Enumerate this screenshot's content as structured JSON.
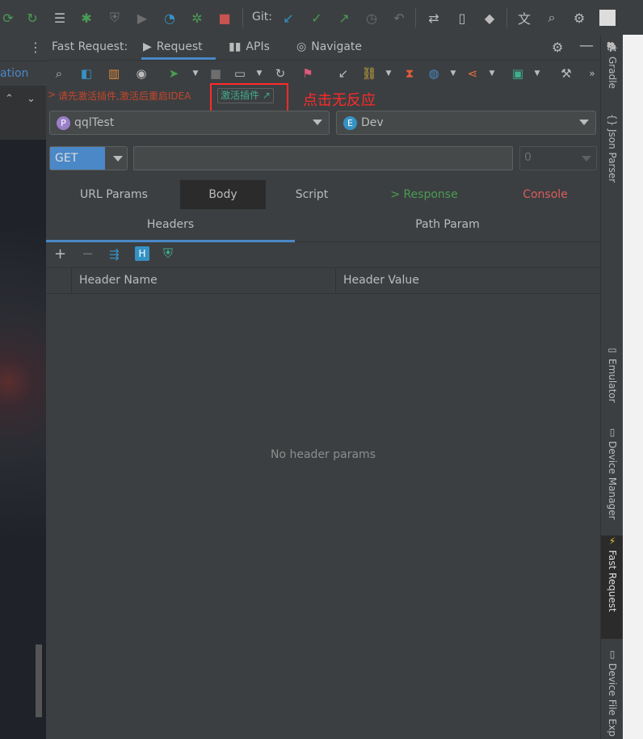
{
  "toolbar": {
    "git_label": "Git:"
  },
  "left": {
    "tab_label": "ation"
  },
  "tool_window": {
    "title": "Fast Request:",
    "tabs": [
      {
        "label": "Request",
        "active": true
      },
      {
        "label": "APIs",
        "active": false
      },
      {
        "label": "Navigate",
        "active": false
      }
    ]
  },
  "notice": {
    "prefix": ">",
    "message": "请先激活插件,激活后重启IDEA",
    "activate_link": "激活插件 ↗",
    "annotation": "点击无反应"
  },
  "selectors": {
    "project": {
      "badge": "P",
      "value": "qqlTest"
    },
    "env": {
      "badge": "E",
      "value": "Dev"
    }
  },
  "request": {
    "method": "GET",
    "url": "",
    "timeout": "0"
  },
  "subtabs": {
    "row1": [
      "URL Params",
      "Body",
      "Script",
      "> Response",
      "Console"
    ],
    "row2": [
      "Headers",
      "Path Param"
    ]
  },
  "table": {
    "columns": [
      "Header Name",
      "Header Value"
    ],
    "empty_text": "No header params"
  },
  "right_sidebar": [
    "Gradle",
    "Json Parser",
    "Emulator",
    "Device Manager",
    "Fast Request",
    "Device File Exp"
  ],
  "colors": {
    "accent": "#4a88c7",
    "annotation_red": "#ff2a2a",
    "response_green": "#499c54",
    "console_red": "#db5c5c"
  }
}
